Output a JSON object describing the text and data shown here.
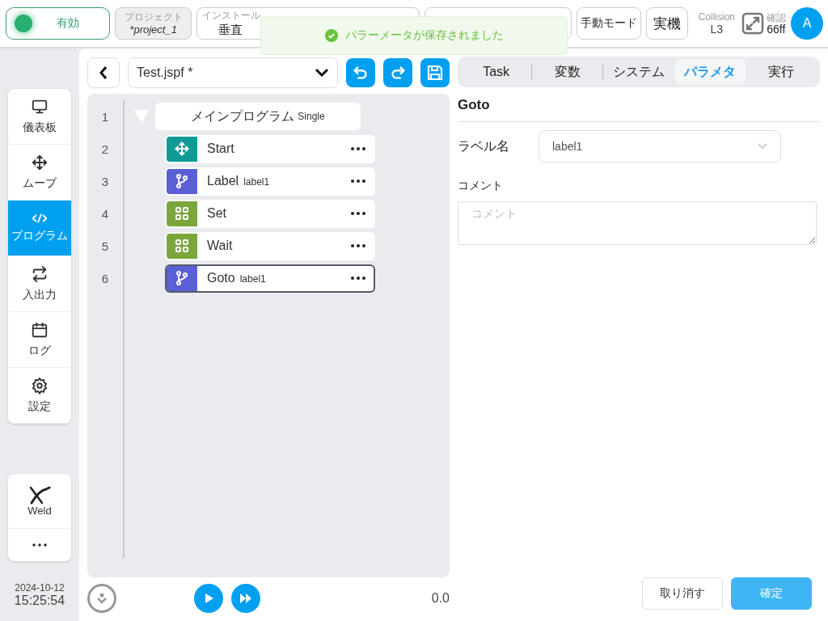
{
  "status": {
    "label": "有効",
    "on": true
  },
  "project": {
    "label": "プロジェクト",
    "value": "*project_1"
  },
  "installation": {
    "label": "インストール",
    "value": "垂直"
  },
  "mode_buttons": [
    "手動モード",
    "実機"
  ],
  "collision": {
    "label": "Collision",
    "value": "L3"
  },
  "confirm": {
    "label": "確認",
    "value": "66ff"
  },
  "user": {
    "initial": "A"
  },
  "toast": {
    "message": "パラーメータが保存されました"
  },
  "nav": [
    {
      "label": "儀表板",
      "selected": false
    },
    {
      "label": "ムーブ",
      "selected": false
    },
    {
      "label": "プログラム",
      "selected": true
    },
    {
      "label": "入出力",
      "selected": false
    },
    {
      "label": "ログ",
      "selected": false
    },
    {
      "label": "設定",
      "selected": false
    }
  ],
  "plugins": [
    {
      "label": "Weld",
      "kind": "weld"
    },
    {
      "kind": "more"
    }
  ],
  "datetime": {
    "date": "2024-10-12",
    "time": "15:25:54"
  },
  "file": {
    "name": "Test.jspf *"
  },
  "tree": {
    "line": "1",
    "title": "メインプログラム",
    "tag": "Single",
    "expanded": true,
    "children": [
      {
        "line": "2",
        "kind": "move",
        "title": "Start",
        "selected": false
      },
      {
        "line": "3",
        "kind": "branch",
        "title": "Label",
        "arg": "label1",
        "selected": false
      },
      {
        "line": "4",
        "kind": "grid",
        "title": "Set",
        "selected": false
      },
      {
        "line": "5",
        "kind": "grid",
        "title": "Wait",
        "selected": false
      },
      {
        "line": "6",
        "kind": "branch",
        "title": "Goto",
        "arg": "label1",
        "selected": true
      }
    ]
  },
  "reading": "0.0",
  "tabs": [
    {
      "label": "Task",
      "selected": false
    },
    {
      "label": "変数",
      "selected": false
    },
    {
      "label": "システム",
      "selected": false
    },
    {
      "label": "パラメタ",
      "selected": true
    },
    {
      "label": "実行",
      "selected": false
    }
  ],
  "panel": {
    "title": "Goto",
    "label_field": {
      "label": "ラベル名",
      "value": "label1"
    },
    "comment": {
      "label": "コメント",
      "placeholder": "コメント"
    }
  },
  "buttons": [
    {
      "label": "取り消す",
      "kind": "secondary"
    },
    {
      "label": "確定",
      "kind": "primary"
    }
  ]
}
